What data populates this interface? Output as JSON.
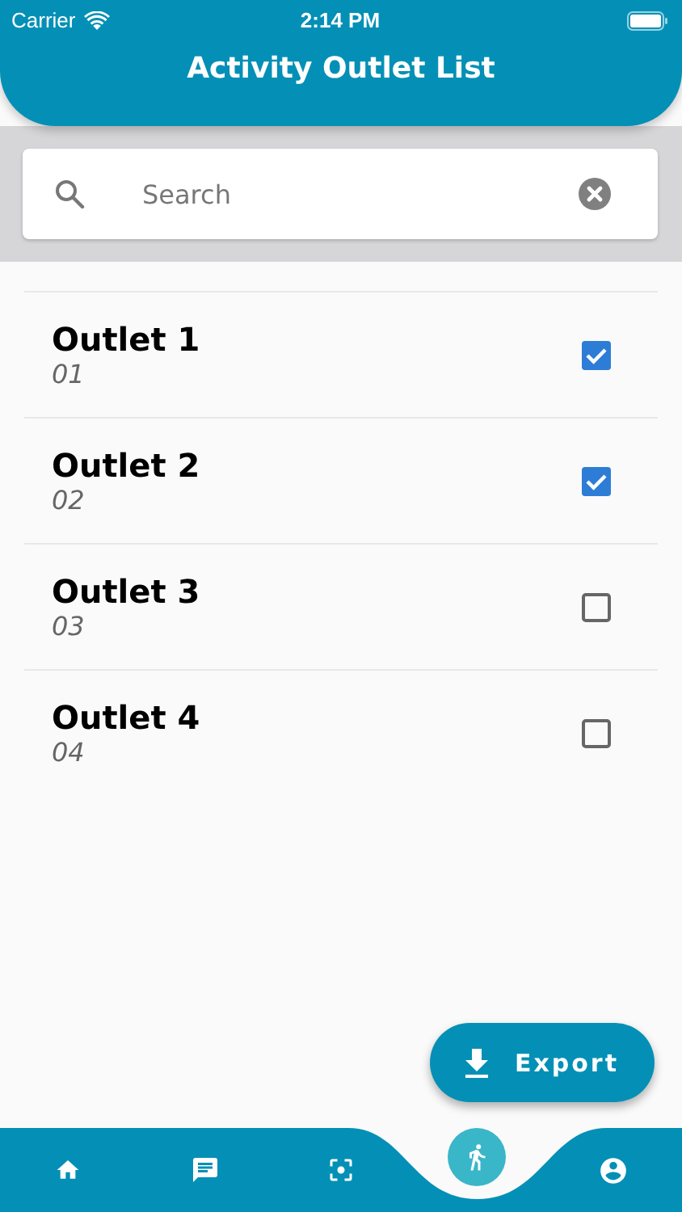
{
  "status_bar": {
    "carrier": "Carrier",
    "time": "2:14 PM"
  },
  "header": {
    "title": "Activity Outlet List"
  },
  "search": {
    "placeholder": "Search"
  },
  "outlets": [
    {
      "name": "Outlet 1",
      "code": "01",
      "checked": true
    },
    {
      "name": "Outlet 2",
      "code": "02",
      "checked": true
    },
    {
      "name": "Outlet 3",
      "code": "03",
      "checked": false
    },
    {
      "name": "Outlet 4",
      "code": "04",
      "checked": false
    }
  ],
  "export_button": {
    "label": "Export"
  },
  "nav": [
    {
      "kind": "home",
      "selected": false
    },
    {
      "kind": "chat",
      "selected": false
    },
    {
      "kind": "focus",
      "selected": false
    },
    {
      "kind": "run",
      "selected": true
    },
    {
      "kind": "profile",
      "selected": false
    }
  ]
}
